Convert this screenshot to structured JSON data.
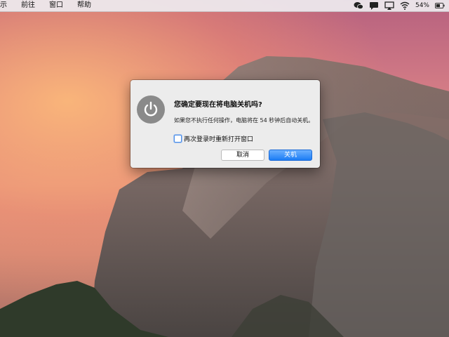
{
  "menubar": {
    "items": [
      "示",
      "前往",
      "窗口",
      "帮助"
    ],
    "battery_percent": "54%",
    "icons": [
      "wechat-icon",
      "message-icon",
      "airplay-icon",
      "wifi-icon",
      "battery-icon"
    ]
  },
  "dialog": {
    "title": "您确定要现在将电脑关机吗?",
    "message": "如果您不执行任何操作，电脑将在 54 秒钟后自动关机。",
    "checkbox_label": "再次登录时重新打开窗口",
    "checkbox_checked": false,
    "cancel_label": "取消",
    "shutdown_label": "关机",
    "icon": "power-icon"
  },
  "colors": {
    "accent": "#1c7cf4",
    "dialog_bg": "#ececec"
  }
}
